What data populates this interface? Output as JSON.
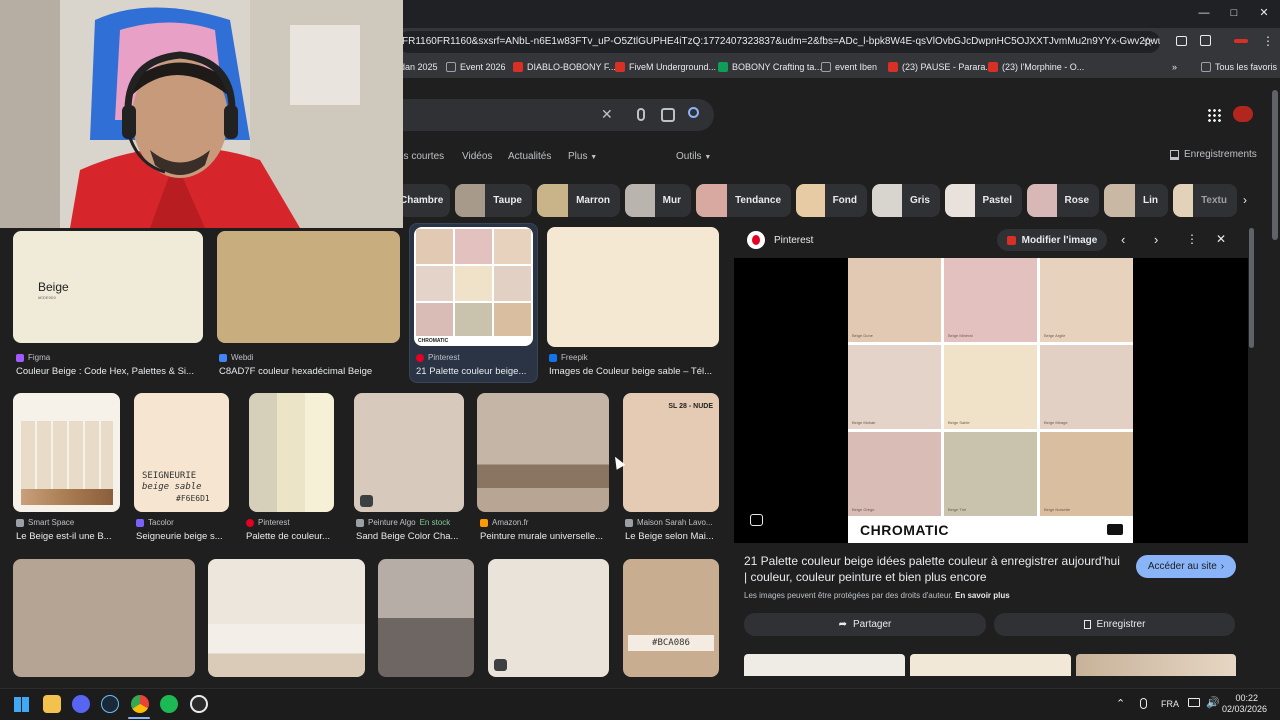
{
  "browser": {
    "url": "FR1160FR1160&sxsrf=ANbL-n6E1w83FTv_uP-O5ZtlGUPHE4iTzQ:1772407323837&udm=2&fbs=ADc_l-bpk8W4E-qsVlOvbGJcDwpnHC5OJXXTJvmMu2n9YYx-Gwv2pwuu9X9wxE...",
    "bookmarks": [
      {
        "label": "dan 2025",
        "color": "#9aa0a6"
      },
      {
        "label": "Event 2026",
        "color": "#9aa0a6"
      },
      {
        "label": "DIABLO-BOBONY F...",
        "color": "#d93025"
      },
      {
        "label": "FiveM Underground...",
        "color": "#d93025"
      },
      {
        "label": "BOBONY Crafting ta...",
        "color": "#0f9d58"
      },
      {
        "label": "event Iben",
        "color": "#9aa0a6"
      },
      {
        "label": "(23) PAUSE - Parara...",
        "color": "#d93025"
      },
      {
        "label": "(23) l'Morphine - O...",
        "color": "#d93025"
      }
    ],
    "all_favorites": "Tous les favoris"
  },
  "tabs": {
    "items": [
      "os courtes",
      "Vidéos",
      "Actualités",
      "Plus"
    ],
    "tools": "Outils",
    "saved": "Enregistrements"
  },
  "chips": [
    {
      "label": "Chambre",
      "color": "#2b2b2b"
    },
    {
      "label": "Taupe",
      "color": "#a89a8a"
    },
    {
      "label": "Marron",
      "color": "#c9b48a"
    },
    {
      "label": "Mur",
      "color": "#b9b4ad"
    },
    {
      "label": "Tendance",
      "color": "#d7a9a0"
    },
    {
      "label": "Fond",
      "color": "#e6cba4"
    },
    {
      "label": "Gris",
      "color": "#d8d5cf"
    },
    {
      "label": "Pastel",
      "color": "#e9e2dc"
    },
    {
      "label": "Rose",
      "color": "#d7b8b6"
    },
    {
      "label": "Lin",
      "color": "#c8b8a4"
    },
    {
      "label": "Textu",
      "color": "#e3d2ba"
    }
  ],
  "results_row1": [
    {
      "source": "Figma",
      "title": "Couleur Beige : Code Hex, Palettes & Si...",
      "img_label": "Beige",
      "img_sub": "#EDE9D0",
      "color": "#efebd8",
      "icon": "#a259ff"
    },
    {
      "source": "Webdi",
      "title": "C8AD7F couleur hexadécimal Beige",
      "color": "#c8ad7f",
      "icon": "#4285f4"
    },
    {
      "source": "Pinterest",
      "title": "21 Palette couleur beige...",
      "color": "#e8dccc",
      "icon": "#e60023"
    },
    {
      "source": "Freepik",
      "title": "Images de Couleur beige sable – Tél...",
      "color": "#f4e8d2",
      "icon": "#1273eb"
    }
  ],
  "results_row2": [
    {
      "source": "Smart Space",
      "title": "Le Beige est-il une B...",
      "color": "#e8dcc8",
      "icon": "#9aa0a6"
    },
    {
      "source": "Tacolor",
      "title": "Seigneurie beige s...",
      "img_label": "SEIGNEURIE",
      "img_sub": "beige sable",
      "img_hex": "#F6E6D1",
      "color": "#f6e6d1",
      "icon": "#7b61ff"
    },
    {
      "source": "Pinterest",
      "title": "Palette de couleur...",
      "color": "#ece4c6",
      "icon": "#e60023"
    },
    {
      "source": "Peinture Algo",
      "stock": "En stock",
      "title": "Sand Beige Color Cha...",
      "color": "#d8c9bd",
      "icon": "#9aa0a6"
    },
    {
      "source": "Amazon.fr",
      "title": "Peinture murale universelle...",
      "color": "#b8a898",
      "icon": "#ff9900"
    },
    {
      "source": "Maison Sarah Lavo...",
      "title": "Le Beige selon Mai...",
      "img_label": "SL 28 - NUDE",
      "color": "#e5cbb3",
      "icon": "#9aa0a6"
    }
  ],
  "results_row3": [
    {
      "color": "#b5a493"
    },
    {
      "color": "#e9e1d6"
    },
    {
      "color": "#8e8580"
    },
    {
      "color": "#e9e3d9"
    },
    {
      "color": "#c9ad90",
      "img_hex": "#BCA086"
    }
  ],
  "preview": {
    "source": "Pinterest",
    "edit_label": "Modifier l'image",
    "palette": [
      {
        "code": "CH1 0226",
        "name": "Beige Dune",
        "color": "#e2c9b4"
      },
      {
        "code": "CH1 0214",
        "name": "Beige Minéral",
        "color": "#e3c1be"
      },
      {
        "code": "CH1 0078",
        "name": "Beige Argile",
        "color": "#e7d3bd"
      },
      {
        "code": "CH1 0321",
        "name": "Beige Mohair",
        "color": "#e3d3c8"
      },
      {
        "code": "CH1 0502",
        "name": "Beige Sable",
        "color": "#f0e2c9"
      },
      {
        "code": "CH1 0324",
        "name": "Beige Mirage",
        "color": "#e3d0c5"
      },
      {
        "code": "CH1 0219",
        "name": "Beige Grège",
        "color": "#d9bcb6"
      },
      {
        "code": "CH1 0503",
        "name": "Beige Thé",
        "color": "#c9c3ad"
      },
      {
        "code": "CH1 0330",
        "name": "Beige Noisette",
        "color": "#d9bf9f"
      }
    ],
    "brand": "CHROMATIC",
    "title": "21 Palette couleur beige idées palette couleur à enregistrer aujourd'hui | couleur, couleur peinture et bien plus encore",
    "copyright": "Les images peuvent être protégées par des droits d'auteur.",
    "learn_more": "En savoir plus",
    "visit_label": "Accéder au site",
    "share_label": "Partager",
    "save_label": "Enregistrer"
  },
  "taskbar": {
    "lang": "FRA",
    "time": "00:22",
    "date": "02/03/2026"
  }
}
